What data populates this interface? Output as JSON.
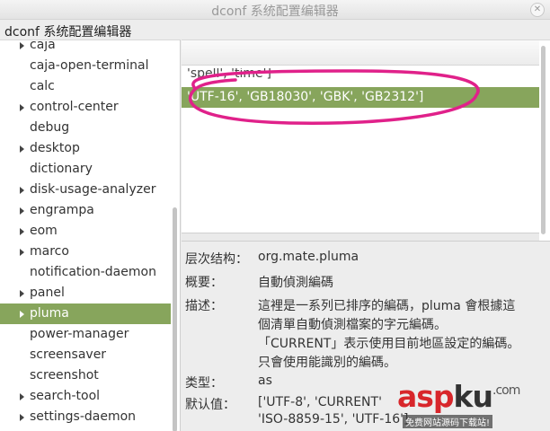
{
  "window": {
    "title": "dconf 系统配置编辑器",
    "close_glyph": "✕"
  },
  "menubar": {
    "app_label": "dconf 系统配置编辑器"
  },
  "tree": {
    "selection_color": "#87a55c",
    "items": [
      {
        "label": "caja",
        "expandable": true,
        "selected": false
      },
      {
        "label": "caja-open-terminal",
        "expandable": false,
        "selected": false
      },
      {
        "label": "calc",
        "expandable": false,
        "selected": false
      },
      {
        "label": "control-center",
        "expandable": true,
        "selected": false
      },
      {
        "label": "debug",
        "expandable": false,
        "selected": false
      },
      {
        "label": "desktop",
        "expandable": true,
        "selected": false
      },
      {
        "label": "dictionary",
        "expandable": false,
        "selected": false
      },
      {
        "label": "disk-usage-analyzer",
        "expandable": true,
        "selected": false
      },
      {
        "label": "engrampa",
        "expandable": true,
        "selected": false
      },
      {
        "label": "eom",
        "expandable": true,
        "selected": false
      },
      {
        "label": "marco",
        "expandable": true,
        "selected": false
      },
      {
        "label": "notification-daemon",
        "expandable": false,
        "selected": false
      },
      {
        "label": "panel",
        "expandable": true,
        "selected": false
      },
      {
        "label": "pluma",
        "expandable": true,
        "selected": true
      },
      {
        "label": "power-manager",
        "expandable": false,
        "selected": false
      },
      {
        "label": "screensaver",
        "expandable": false,
        "selected": false
      },
      {
        "label": "screenshot",
        "expandable": false,
        "selected": false
      },
      {
        "label": "search-tool",
        "expandable": true,
        "selected": false
      },
      {
        "label": "settings-daemon",
        "expandable": true,
        "selected": false
      }
    ]
  },
  "values": {
    "rows": [
      {
        "text": "'spell', 'time']",
        "selected": false
      },
      {
        "text": "'UTF-16', 'GB18030', 'GBK', 'GB2312']",
        "selected": true
      }
    ],
    "annotation_color": "#e0218a"
  },
  "details": {
    "schema_label": "层次结构：",
    "schema_value": "org.mate.pluma",
    "summary_label": "概要：",
    "summary_value": "自動偵測編碼",
    "description_label": "描述：",
    "description_lines": [
      "這裡是一系列已排序的編碼，pluma 會根據這",
      "個清單自動偵測檔案的字元編碼。",
      "「CURRENT」表示使用目前地區設定的編碼。",
      "只會使用能識別的編碼。"
    ],
    "type_label": "类型：",
    "type_value": "as",
    "default_label": "默认值：",
    "default_lines": [
      "['UTF-8', 'CURRENT'",
      "'ISO-8859-15', 'UTF-16']"
    ]
  },
  "watermark": {
    "brand_red": "asp",
    "brand_dark": "ku",
    "brand_suffix": ".com",
    "tagline": "免费网站源码下载站!",
    "red": "#d8262b"
  }
}
